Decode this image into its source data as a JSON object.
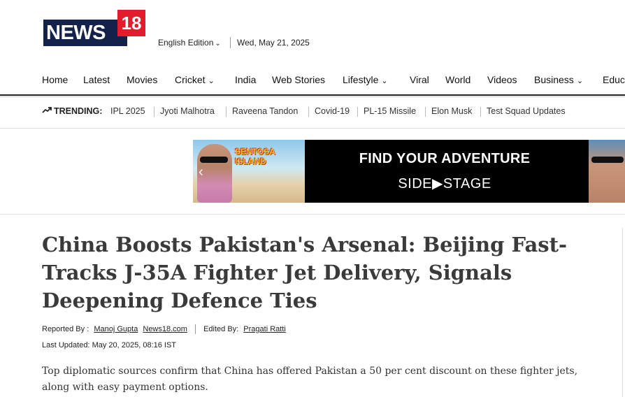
{
  "logo": {
    "text": "NEWS",
    "number": "18"
  },
  "header": {
    "edition": "English Edition",
    "date": "Wed, May 21, 2025"
  },
  "nav": {
    "items": [
      {
        "label": "Home",
        "dropdown": false
      },
      {
        "label": "Latest",
        "dropdown": false
      },
      {
        "label": "Movies",
        "dropdown": false
      },
      {
        "label": "Cricket",
        "dropdown": true
      },
      {
        "label": "India",
        "dropdown": false
      },
      {
        "label": "Web Stories",
        "dropdown": false
      },
      {
        "label": "Lifestyle",
        "dropdown": true
      },
      {
        "label": "Viral",
        "dropdown": false
      },
      {
        "label": "World",
        "dropdown": false
      },
      {
        "label": "Videos",
        "dropdown": false
      },
      {
        "label": "Business",
        "dropdown": true
      },
      {
        "label": "Educ",
        "dropdown": false
      }
    ]
  },
  "trending": {
    "label": "TRENDING:",
    "items": [
      "IPL 2025",
      "Jyoti Malhotra",
      "Raveena Tandon",
      "Covid-19",
      "PL-15 Missile",
      "Elon Musk",
      "Test Squad Updates"
    ]
  },
  "ad": {
    "badge": "SENTOSA ISLAND",
    "headline": "FIND YOUR ADVENTURE",
    "brand": "SIDE▶STAGE"
  },
  "article": {
    "headline": "China Boosts Pakistan's Arsenal: Beijing Fast-Tracks J-35A Fighter Jet Delivery, Signals Deepening Defence Ties",
    "reported_by_label": "Reported By :",
    "reporter": "Manoj Gupta",
    "source": "News18.com",
    "edited_by_label": "Edited By:",
    "editor": "Pragati Ratti",
    "updated_label": "Last Updated:",
    "updated": "May 20, 2025, 08:16 IST",
    "lede": "Top diplomatic sources confirm that China has offered Pakistan a 50 per cent discount on these fighter jets, along with easy payment options."
  },
  "colors": {
    "logo_navy": "#14214a",
    "logo_red": "#e21c2d",
    "ad_yellow": "#f6c11a"
  }
}
